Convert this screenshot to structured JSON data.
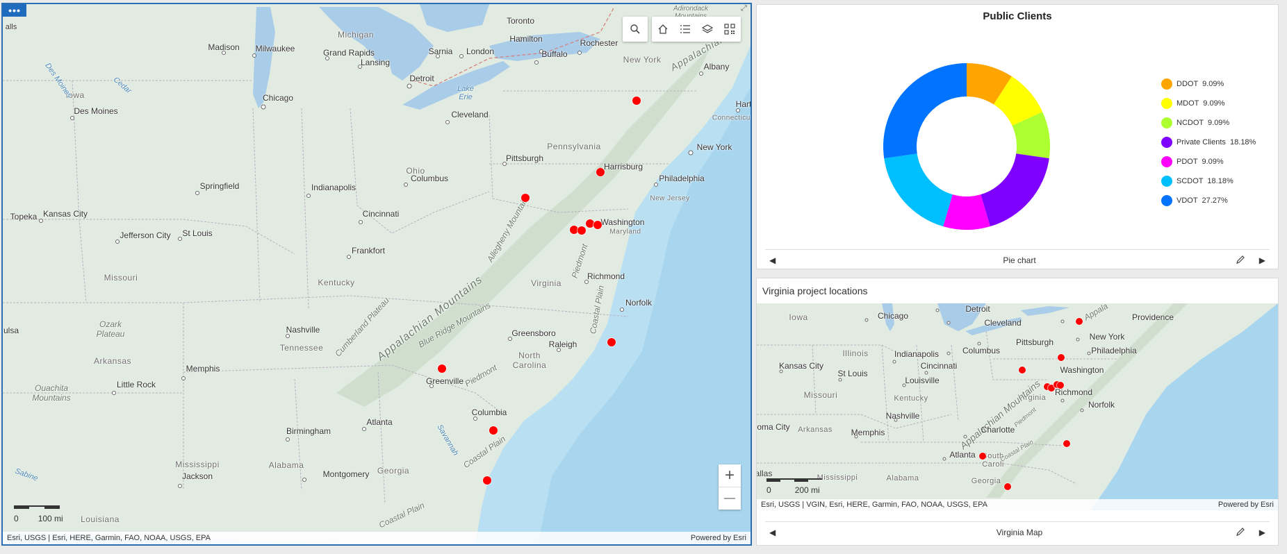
{
  "main_map": {
    "menu_label": "•••",
    "attribution": "Esri, USGS | Esri, HERE, Garmin, FAO, NOAA, USGS, EPA",
    "powered_by": "Powered by Esri",
    "scale_zero": "0",
    "scale_label": "100 mi",
    "zoom_in": "+",
    "zoom_out": "—",
    "toolbar": [
      "search-icon",
      "home-icon",
      "legend-icon",
      "layers-icon",
      "qr-code-icon"
    ],
    "labels": {
      "toronto": "Toronto",
      "hamilton": "Hamilton",
      "rochester": "Rochester",
      "buffalo": "Buffalo",
      "sarnia": "Sarnia",
      "london": "London",
      "detroit": "Detroit",
      "lake_erie": "Lake\nErie",
      "cleveland": "Cleveland",
      "madison": "Madison",
      "milwaukee": "Milwaukee",
      "michigan": "Michigan",
      "grand_rapids": "Grand Rapids",
      "lansing": "Lansing",
      "chicago": "Chicago",
      "iowa": "Iowa",
      "des_moines": "Des Moines",
      "des_moines_river": "Des Moines",
      "cedar": "Cedar",
      "illinois_frag": "alls",
      "new_york_state": "New York",
      "albany": "Albany",
      "appalachian_top": "Appalachian",
      "adirondack": "Adirondack\nMountains",
      "hartford": "Hart",
      "connecticut": "Connecticut",
      "pennsylvania": "Pennsylvania",
      "new_york_city": "New York",
      "pittsburgh": "Pittsburgh",
      "harrisburg": "Harrisburg",
      "philadelphia": "Philadelphia",
      "new_jersey": "New Jersey",
      "ohio": "Ohio",
      "columbus": "Columbus",
      "springfield": "Springfield",
      "indianapolis": "Indianapolis",
      "cincinnati": "Cincinnati",
      "washington": "Washington",
      "maryland": "Maryland",
      "allegheny": "Allegheny Mountains",
      "topeka": "Topeka",
      "kansas_city": "Kansas City",
      "jefferson_city": "Jefferson City",
      "st_louis": "St Louis",
      "frankfort": "Frankfort",
      "piedmont": "Piedmont",
      "richmond": "Richmond",
      "missouri": "Missouri",
      "kentucky": "Kentucky",
      "virginia": "Virginia",
      "coastal_plain": "Coastal Plain",
      "norfolk": "Norfolk",
      "appalachian_mountains": "Appalachian Mountains",
      "cumberland": "Cumberland Plateau",
      "ozark": "Ozark\nPlateau",
      "nashville": "Nashville",
      "blue_ridge": "Blue Ridge Mountains",
      "greensboro": "Greensboro",
      "raleigh": "Raleigh",
      "north_carolina": "North\nCarolina",
      "tulsa": "ulsa",
      "tennessee": "Tennessee",
      "arkansas": "Arkansas",
      "memphis": "Memphis",
      "little_rock": "Little Rock",
      "greenville": "Greenville",
      "piedmont2": "Piedmont",
      "ouachita": "Ouachita\nMountains",
      "columbia": "Columbia",
      "birmingham": "Birmingham",
      "atlanta": "Atlanta",
      "savannah": "Savannah",
      "coastal_plain2": "Coastal Plain",
      "mississippi": "Mississippi",
      "jackson": "Jackson",
      "alabama": "Alabama",
      "montgomery": "Montgomery",
      "georgia": "Georgia",
      "sabine": "Sabine",
      "coastal_plain3": "Coastal Plain",
      "louisiana": "Louisiana"
    },
    "marker_color": "#ff0000"
  },
  "chart_panel": {
    "footer_label": "Pie chart"
  },
  "chart_data": {
    "type": "pie",
    "title": "Public Clients",
    "donut": true,
    "legend_position": "right",
    "slices": [
      {
        "label": "DDOT",
        "percent": 9.09,
        "display": "9.09%",
        "color": "#ffa500"
      },
      {
        "label": "MDOT",
        "percent": 9.09,
        "display": "9.09%",
        "color": "#ffff00"
      },
      {
        "label": "NCDOT",
        "percent": 9.09,
        "display": "9.09%",
        "color": "#adff2f"
      },
      {
        "label": "Private Clients",
        "percent": 18.18,
        "display": "18.18%",
        "color": "#8000ff"
      },
      {
        "label": "PDOT",
        "percent": 9.09,
        "display": "9.09%",
        "color": "#ff00ff"
      },
      {
        "label": "SCDOT",
        "percent": 18.18,
        "display": "18.18%",
        "color": "#00bfff"
      },
      {
        "label": "VDOT",
        "percent": 27.27,
        "display": "27.27%",
        "color": "#0073ff"
      }
    ]
  },
  "va_panel": {
    "title": "Virginia project locations",
    "footer_label": "Virginia Map",
    "attribution": "Esri, USGS | VGIN, Esri, HERE, Garmin, FAO, NOAA, USGS, EPA",
    "powered_by": "Powered by Esri",
    "scale_zero": "0",
    "scale_label": "200 mi",
    "labels": {
      "iowa": "Iowa",
      "chicago": "Chicago",
      "detroit": "Detroit",
      "cleveland": "Cleveland",
      "appalachian": "Appala",
      "providence": "Providence",
      "new_york": "New York",
      "illinois": "Illinois",
      "pittsburgh": "Pittsburgh",
      "indianapolis": "Indianapolis",
      "columbus": "Columbus",
      "philadelphia": "Philadelphia",
      "kansas_city": "Kansas City",
      "cincinnati": "Cincinnati",
      "st_louis": "St Louis",
      "washington": "Washington",
      "louisville": "Louisville",
      "missouri": "Missouri",
      "kentucky": "Kentucky",
      "richmond": "Richmond",
      "virginia": "Virginia",
      "appalachian_mtns": "Appalachian Mountains",
      "norfolk": "Norfolk",
      "nashville": "Nashville",
      "piedmont": "Piedmont",
      "oma_city": "oma City",
      "arkansas": "Arkansas",
      "memphis": "Memphis",
      "charlotte": "Charlotte",
      "atlanta": "Atlanta",
      "south_carolina": "South\nCaroli",
      "coastal_plain": "Coastal Plain",
      "allas": "allas",
      "mississippi": "Mississippi",
      "alabama": "Alabama",
      "georgia": "Georgia"
    }
  }
}
